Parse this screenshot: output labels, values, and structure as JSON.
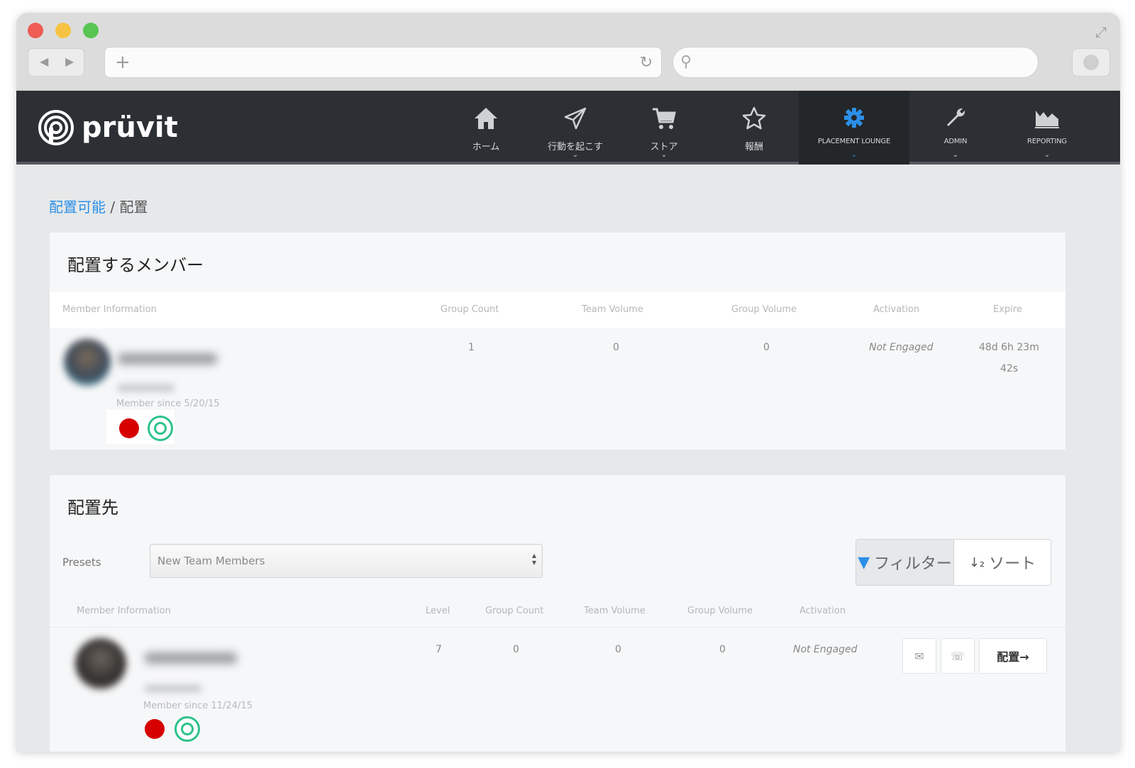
{
  "app": {
    "name": "prüvit"
  },
  "nav": {
    "home": "ホーム",
    "take_action": "行動を起こす",
    "store": "ストア",
    "rewards": "報酬",
    "placement_lounge": "PLACEMENT LOUNGE",
    "admin": "ADMIN",
    "reporting": "REPORTING",
    "accent_color": "#2b8fe8"
  },
  "breadcrumb": {
    "parent": "配置可能",
    "separator": "/",
    "current": "配置"
  },
  "member_to_place": {
    "title": "配置するメンバー",
    "columns": [
      "Member Information",
      "Group Count",
      "Team Volume",
      "Group Volume",
      "Activation",
      "Expire"
    ],
    "row": {
      "member_since": "Member since 5/20/15",
      "group_count": "1",
      "team_volume": "0",
      "group_volume": "0",
      "activation": "Not Engaged",
      "expire_line1": "48d 6h 23m",
      "expire_line2": "42s"
    }
  },
  "placement_target": {
    "title": "配置先",
    "presets_label": "Presets",
    "preset_selected": "New Team Members",
    "filter_label": "フィルター",
    "sort_label": "ソート",
    "columns": [
      "Member Information",
      "Level",
      "Group Count",
      "Team Volume",
      "Group Volume",
      "Activation"
    ],
    "row": {
      "member_since": "Member since 11/24/15",
      "level": "7",
      "group_count": "0",
      "team_volume": "0",
      "group_volume": "0",
      "activation": "Not Engaged",
      "place_label": "配置→"
    }
  }
}
